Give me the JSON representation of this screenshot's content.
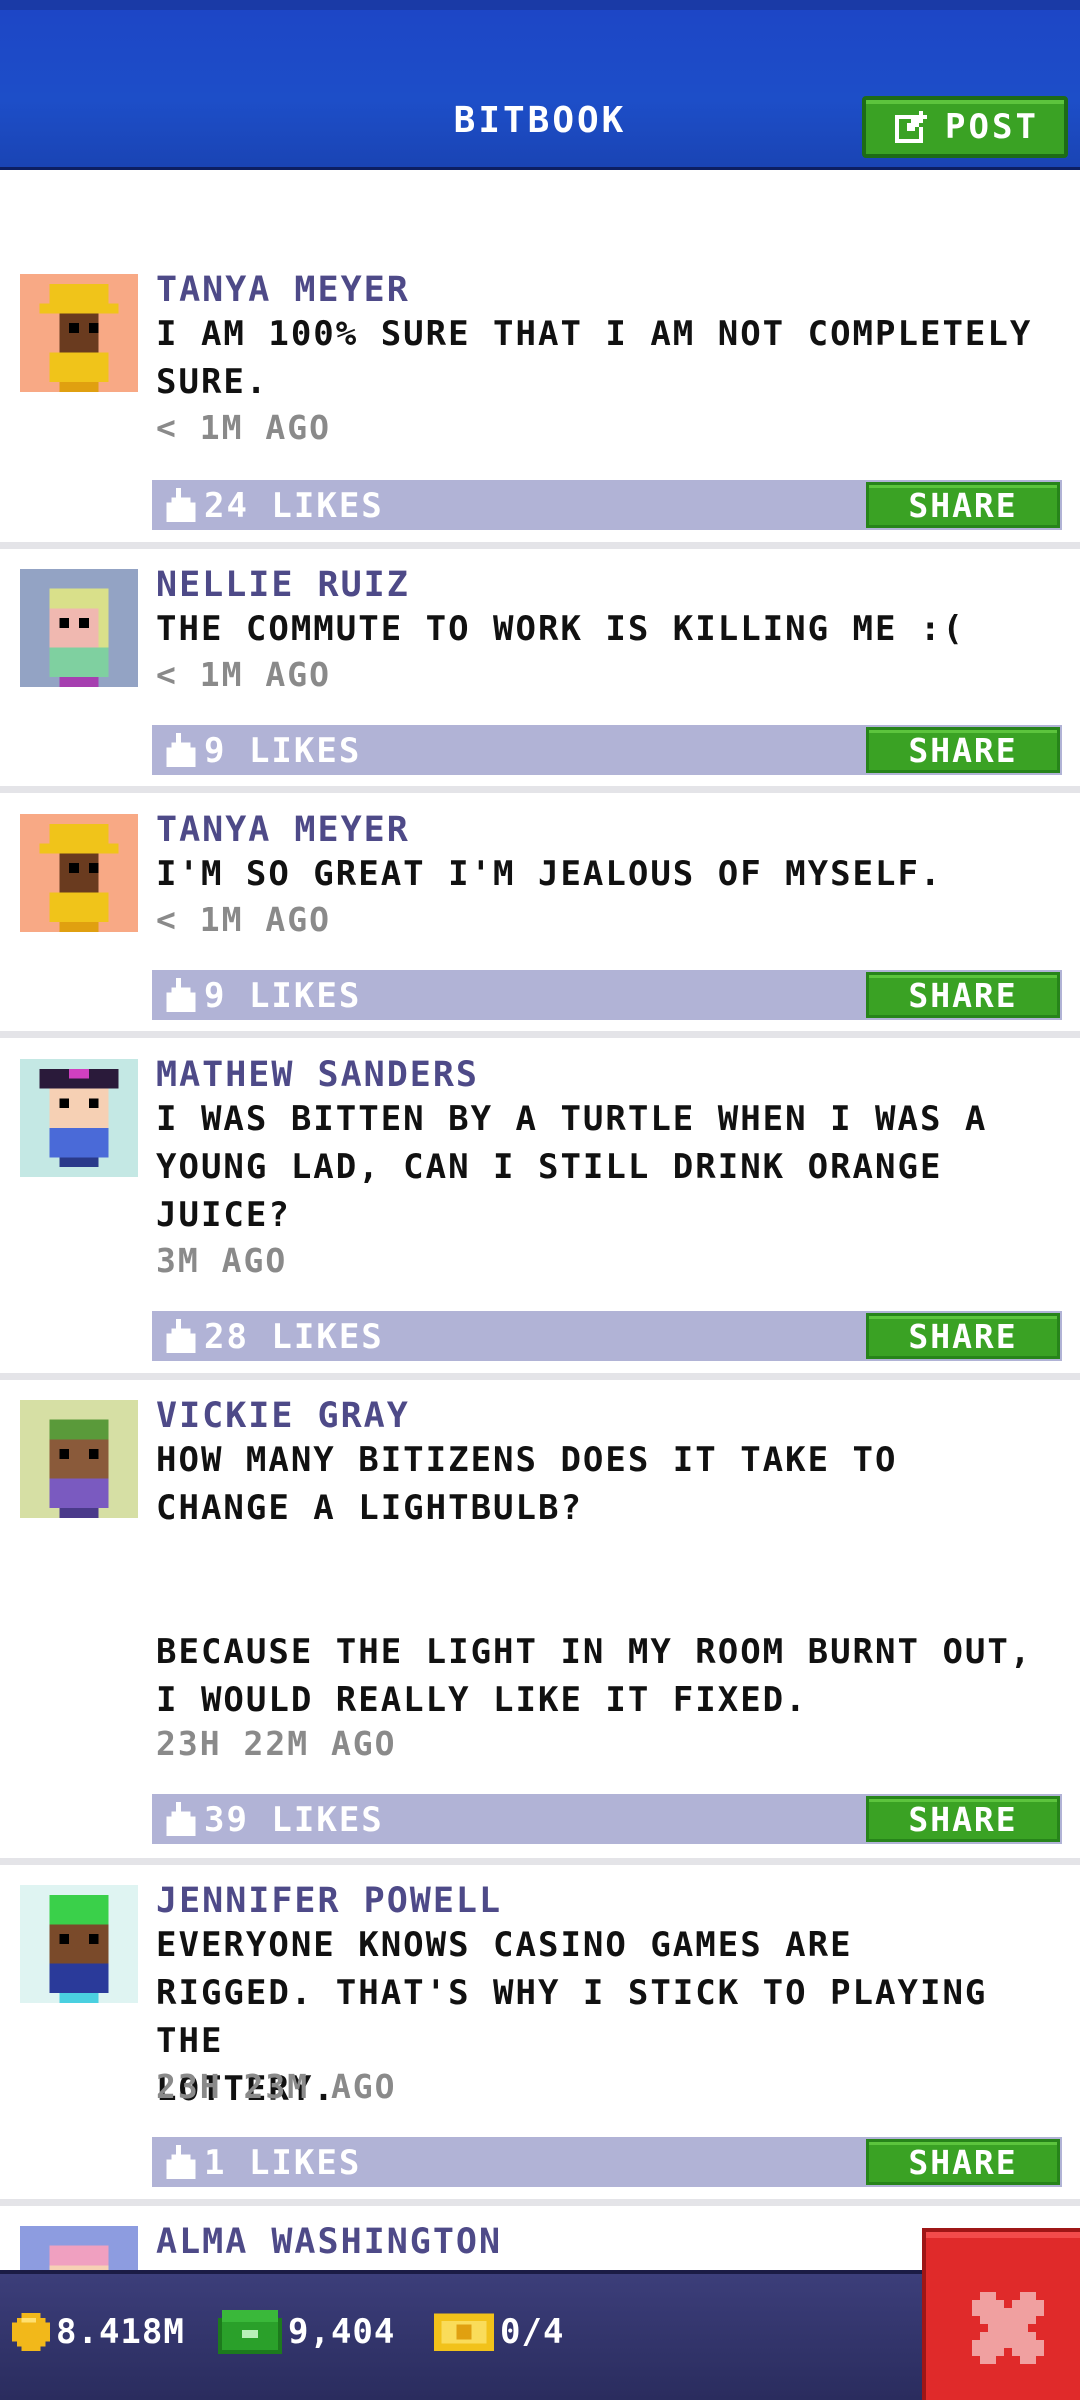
{
  "header": {
    "title": "BITBOOK",
    "post_label": "POST"
  },
  "posts": [
    {
      "author": "TANYA MEYER",
      "message": "I AM 100% SURE THAT I AM NOT COMPLETELY\nSURE.",
      "time": "< 1M AGO",
      "likes": "24 LIKES",
      "share": "SHARE",
      "avatar": "avatar-yellow-hat"
    },
    {
      "author": "NELLIE RUIZ",
      "message": "THE COMMUTE TO WORK IS KILLING ME :(",
      "time": "< 1M AGO",
      "likes": "9 LIKES",
      "share": "SHARE",
      "avatar": "avatar-blonde-woman"
    },
    {
      "author": "TANYA MEYER",
      "message": "I'M SO GREAT I'M JEALOUS OF MYSELF.",
      "time": "< 1M AGO",
      "likes": "9 LIKES",
      "share": "SHARE",
      "avatar": "avatar-yellow-hat"
    },
    {
      "author": "MATHEW SANDERS",
      "message": "I WAS BITTEN BY A TURTLE WHEN I WAS A\nYOUNG LAD, CAN I STILL DRINK ORANGE\nJUICE?",
      "time": "3M AGO",
      "likes": "28 LIKES",
      "share": "SHARE",
      "avatar": "avatar-pirate-hat"
    },
    {
      "author": "VICKIE GRAY",
      "message": "HOW MANY BITIZENS DOES IT TAKE TO\nCHANGE A LIGHTBULB?\n\n\nBECAUSE THE LIGHT IN MY ROOM BURNT OUT,\nI WOULD REALLY LIKE IT FIXED.",
      "time": "23H 22M AGO",
      "likes": "39 LIKES",
      "share": "SHARE",
      "avatar": "avatar-green-hair"
    },
    {
      "author": "JENNIFER POWELL",
      "message": "EVERYONE KNOWS CASINO GAMES ARE\nRIGGED. THAT'S WHY I STICK TO PLAYING THE\nLOTTERY.",
      "time": "23H 23M AGO",
      "likes": "1 LIKES",
      "share": "SHARE",
      "avatar": "avatar-green-cap"
    },
    {
      "author": "ALMA WASHINGTON",
      "message": "",
      "time": "",
      "likes": "",
      "share": "",
      "avatar": "avatar-pink-hair"
    }
  ],
  "bottom_bar": {
    "coins": "8.418M",
    "bux": "9,404",
    "tickets": "0/4"
  },
  "colors": {
    "header_blue": "#1d4ec8",
    "share_green": "#3aa224",
    "likes_bar": "#b1b3d6",
    "author_purple": "#4e4a88",
    "close_red": "#e02a2a"
  }
}
